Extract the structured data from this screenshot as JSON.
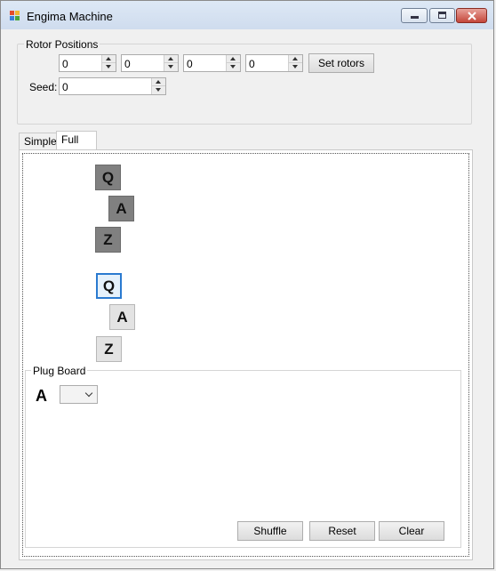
{
  "window": {
    "title": "Engima Machine"
  },
  "rotors": {
    "group_label": "Rotor Positions",
    "values": [
      "0",
      "0",
      "0",
      "0"
    ],
    "set_button": "Set rotors",
    "seed_label": "Seed:",
    "seed_value": "0"
  },
  "tabs": [
    {
      "label": "Simple",
      "active": false
    },
    {
      "label": "Full",
      "active": true
    }
  ],
  "lamp_rows": [
    {
      "letters": [
        "Q",
        "A",
        "Z"
      ],
      "style": "dark"
    },
    {
      "letters": [
        "Q",
        "A",
        "Z"
      ],
      "style": "light",
      "focused_index": 0
    }
  ],
  "plug_board": {
    "label": "Plug Board",
    "letter": "A",
    "combo_value": "",
    "buttons": {
      "shuffle": "Shuffle",
      "reset": "Reset",
      "clear": "Clear"
    }
  },
  "colors": {
    "lamp_dark": "#808080",
    "lamp_light": "#e3e3e3",
    "focus": "#2a7ad0"
  },
  "icons": [
    "app-icon",
    "minimize-icon",
    "maximize-icon",
    "close-icon",
    "spin-up-icon",
    "spin-down-icon",
    "dropdown-chevron-icon"
  ]
}
